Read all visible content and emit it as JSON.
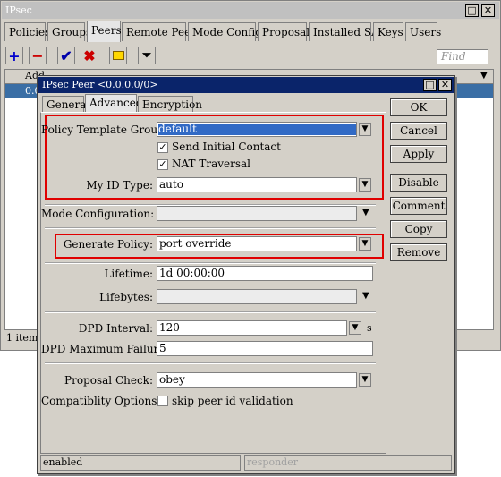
{
  "main_window": {
    "title": "IPsec",
    "tabs": [
      "Policies",
      "Groups",
      "Peers",
      "Remote Peers",
      "Mode Configs",
      "Proposals",
      "Installed SAs",
      "Keys",
      "Users"
    ],
    "active_tab": "Peers",
    "find_placeholder": "Find",
    "list_header_partial": "Add",
    "list_row_partial": "0.0",
    "status_partial": "1 item (",
    "colors": {
      "accent": "#0a246a",
      "add": "#0000cc",
      "remove": "#cc0000",
      "check": "#0000aa"
    }
  },
  "dialog": {
    "title": "IPsec Peer <0.0.0.0/0>",
    "tabs": [
      "General",
      "Advanced",
      "Encryption"
    ],
    "active_tab": "Advanced",
    "fields": {
      "policy_template_group": {
        "label": "Policy Template Group:",
        "value": "default"
      },
      "send_initial_contact": {
        "label": "Send Initial Contact",
        "checked": true
      },
      "nat_traversal": {
        "label": "NAT Traversal",
        "checked": true
      },
      "my_id_type": {
        "label": "My ID Type:",
        "value": "auto"
      },
      "mode_configuration": {
        "label": "Mode Configuration:",
        "value": ""
      },
      "generate_policy": {
        "label": "Generate Policy:",
        "value": "port override"
      },
      "lifetime": {
        "label": "Lifetime:",
        "value": "1d 00:00:00"
      },
      "lifebytes": {
        "label": "Lifebytes:",
        "value": ""
      },
      "dpd_interval": {
        "label": "DPD Interval:",
        "value": "120",
        "unit": "s"
      },
      "dpd_max_failures": {
        "label": "DPD Maximum Failures:",
        "value": "5"
      },
      "proposal_check": {
        "label": "Proposal Check:",
        "value": "obey"
      },
      "compatibility_options": {
        "label": "Compatiblity Options:",
        "option": "skip peer id validation",
        "checked": false
      }
    },
    "buttons": [
      "OK",
      "Cancel",
      "Apply",
      "Disable",
      "Comment",
      "Copy",
      "Remove"
    ],
    "status_left": "enabled",
    "status_right": "responder"
  }
}
